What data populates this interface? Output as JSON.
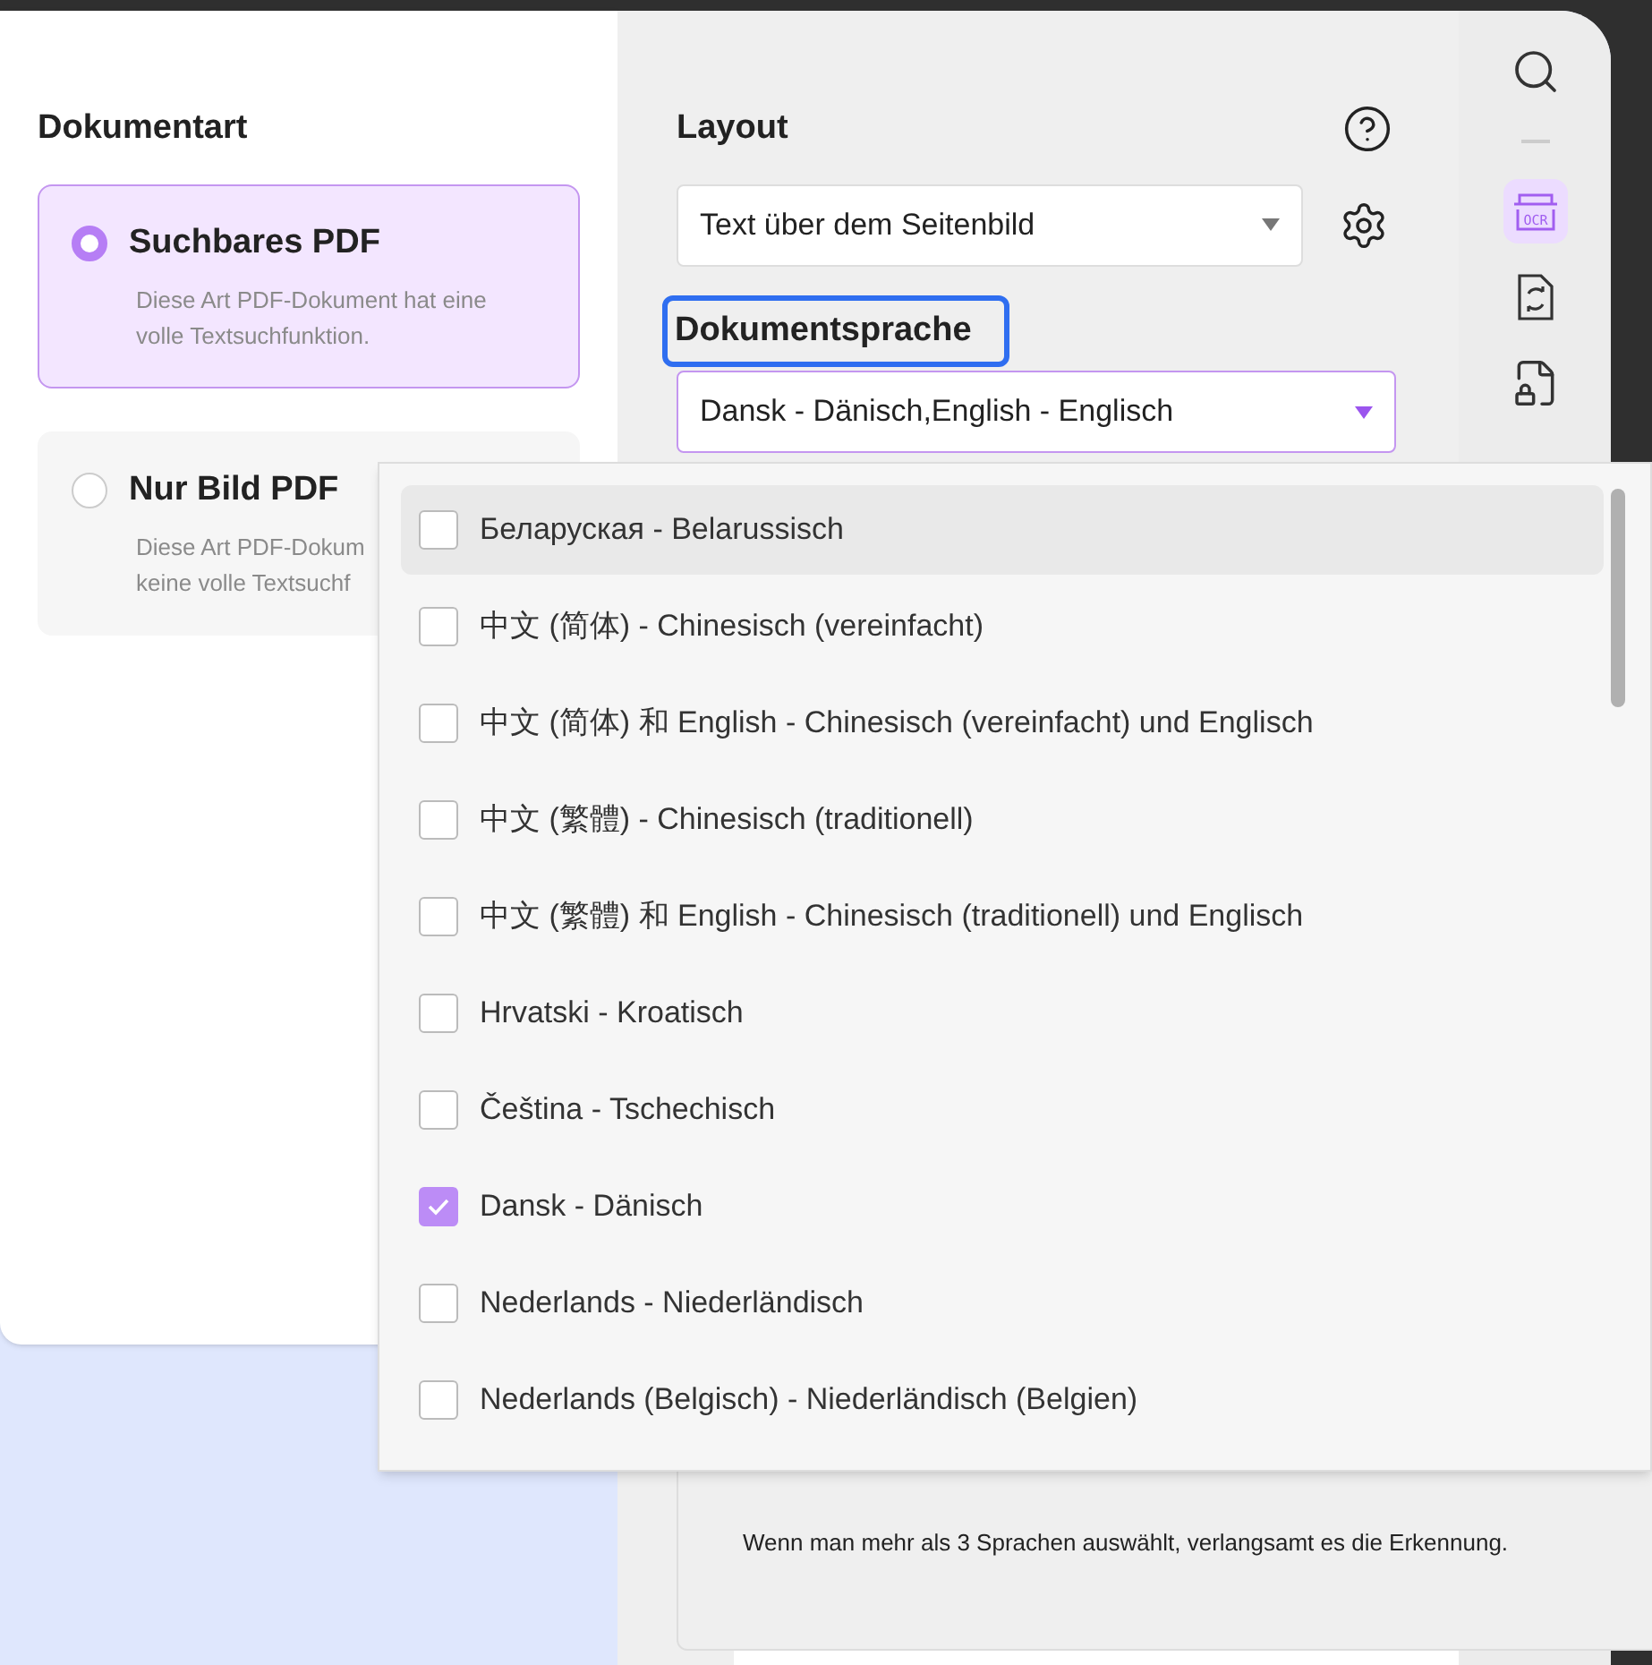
{
  "document_type": {
    "heading": "Dokumentart",
    "options": [
      {
        "title": "Suchbares PDF",
        "description": "Diese Art PDF-Dokument hat eine\nvolle Textsuchfunktion.",
        "selected": true
      },
      {
        "title": "Nur Bild PDF",
        "description": "Diese Art PDF-Dokum\nkeine volle Textsuchf",
        "selected": false
      }
    ]
  },
  "layout": {
    "heading": "Layout",
    "value": "Text über dem Seitenbild"
  },
  "language": {
    "heading": "Dokumentsprache",
    "value": "Dansk - Dänisch,English - Englisch"
  },
  "language_list": [
    {
      "label": "Беларуская - Belarussisch",
      "checked": false,
      "highlighted": true
    },
    {
      "label": "中文 (简体) - Chinesisch (vereinfacht)",
      "checked": false,
      "highlighted": false
    },
    {
      "label": "中文 (简体) 和 English - Chinesisch (vereinfacht) und Englisch",
      "checked": false,
      "highlighted": false
    },
    {
      "label": "中文 (繁體) - Chinesisch (traditionell)",
      "checked": false,
      "highlighted": false
    },
    {
      "label": "中文 (繁體) 和 English - Chinesisch (traditionell) und Englisch",
      "checked": false,
      "highlighted": false
    },
    {
      "label": "Hrvatski - Kroatisch",
      "checked": false,
      "highlighted": false
    },
    {
      "label": "Čeština - Tschechisch",
      "checked": false,
      "highlighted": false
    },
    {
      "label": "Dansk - Dänisch",
      "checked": true,
      "highlighted": false
    },
    {
      "label": "Nederlands - Niederländisch",
      "checked": false,
      "highlighted": false
    },
    {
      "label": "Nederlands (Belgisch) - Niederländisch (Belgien)",
      "checked": false,
      "highlighted": false
    }
  ],
  "note": "Wenn man mehr als 3 Sprachen auswählt, verlangsamt es die Erkennung.",
  "sidebar": {
    "ocr_label": "OCR",
    "tools": [
      {
        "kind": "search",
        "selected": false
      },
      {
        "kind": "ocr",
        "selected": true
      },
      {
        "kind": "convert",
        "selected": false
      },
      {
        "kind": "protect",
        "selected": false
      }
    ]
  }
}
